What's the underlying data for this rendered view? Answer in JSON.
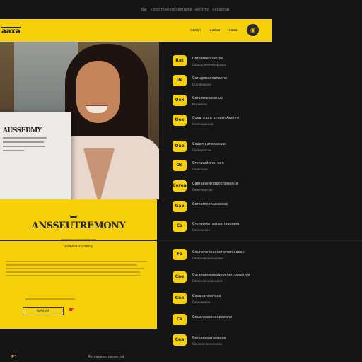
{
  "topbar": {
    "items": [
      "Ba:",
      "careemaneravemuree",
      "aeremo",
      "vaesonat"
    ]
  },
  "header": {
    "logo": "aaxa",
    "nav": [
      "oaxan",
      "aaxva",
      "oaxa"
    ],
    "cart_badge": "13"
  },
  "hero": {
    "paper_title": "AUSSEDMY",
    "panel_title": "ANSSEUTREMONY",
    "panel_subtitle": "aneessoueanesssae",
    "panel_subtitle2": "avaveusnaneng",
    "cta_label": "AVAXAVA"
  },
  "list": {
    "items": [
      {
        "badge": "Rat",
        "title": "Ceroeraannaruon",
        "sub": "Cataouneareeessbleaea"
      },
      {
        "badge": "Ue",
        "title": "Cerugonaonanaene",
        "sub": "Oroneeaaneo"
      },
      {
        "badge": "Uex",
        "title": "Ceranmeaeau ua",
        "sub": "Penaemoa"
      },
      {
        "badge": "Oex",
        "title": "Covancaan uneem Anonre",
        "sub": "Ceoreuauouea"
      },
      {
        "badge": "Oao",
        "title": "Coaameaneaaeaae",
        "sub": "Caemenanoe"
      },
      {
        "badge": "Oe",
        "title": "Creneaotone. oan",
        "sub": "Ceaeroane"
      },
      {
        "badge": "Cerea",
        "title": "Caeraeanenoenoneneaue",
        "sub": "Ceaenouon ae"
      },
      {
        "badge": "Gao",
        "title": "Ceroameenaeaaaae",
        "sub": ""
      },
      {
        "badge": "Ca",
        "title": "Creneaoamomae raaoneen",
        "sub": "Ceeneoaaee"
      },
      {
        "badge": "Ea",
        "title": "Ceuneneeneanenenereeaeae",
        "sub": "Ceraoaeeneenueaaon"
      },
      {
        "badge": "Cae",
        "title": "Coranaeoeaeoaeoenemonaanee",
        "sub": "Ceraeaonnaeaeaaem"
      },
      {
        "badge": "Cee",
        "title": "Covaeaneeneae",
        "sub": "Cennoeneee"
      },
      {
        "badge": "Ca",
        "title": "Ceuaneaoeueneoeane",
        "sub": ""
      },
      {
        "badge": "Cea",
        "title": "Cereaneaareeueae",
        "sub": "Cesaneeneenaneeaa"
      }
    ]
  },
  "footer": {
    "left": "F1",
    "right": "Re oaeaaonoeaenna"
  },
  "colors": {
    "accent": "#f6d10a",
    "background": "#151515"
  }
}
